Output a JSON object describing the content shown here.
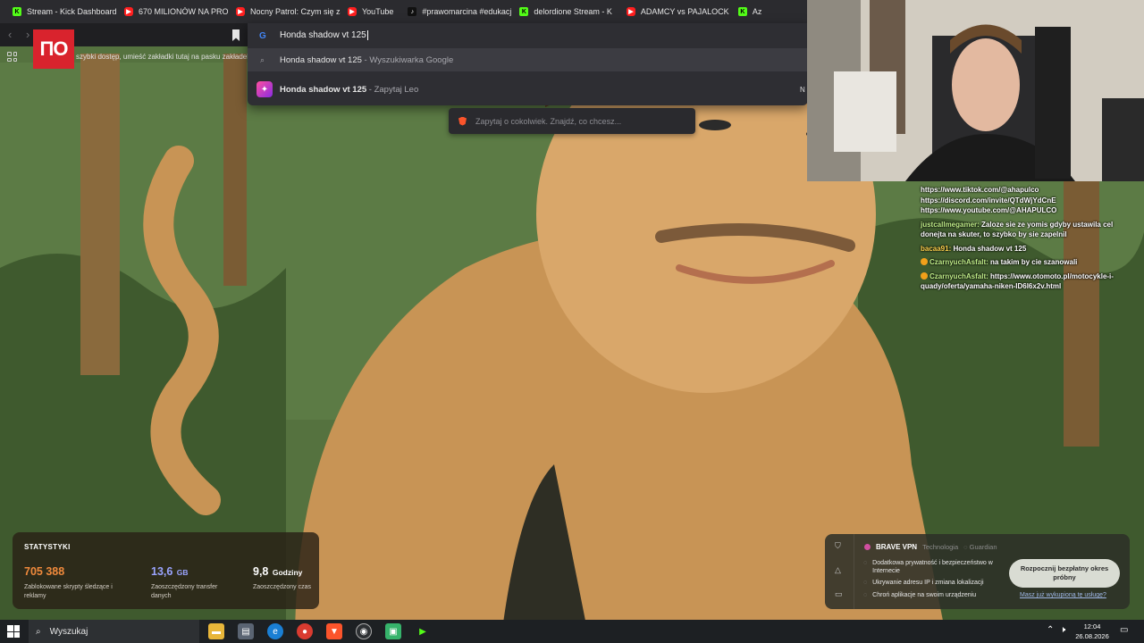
{
  "bookmarks": [
    {
      "icon": "kick-icon",
      "label": "Stream - Kick Dashboard"
    },
    {
      "icon": "youtube-icon",
      "label": "670 MILIONÓW NA PROM"
    },
    {
      "icon": "youtube-icon",
      "label": "Nocny Patrol: Czym się za"
    },
    {
      "icon": "youtube-icon",
      "label": "YouTube"
    },
    {
      "icon": "tiktok-icon",
      "label": "#prawomarcina #edukacj"
    },
    {
      "icon": "kick-icon",
      "label": "delordione Stream - K"
    },
    {
      "icon": "youtube-icon",
      "label": "ADAMCY vs PAJALOCK K"
    },
    {
      "icon": "kick-icon",
      "label": "Az"
    }
  ],
  "omnibox": {
    "query": "Honda shadow vt 125",
    "suggestions": [
      {
        "main": "Honda shadow vt 125",
        "suffix": " - Wyszukiwarka Google"
      },
      {
        "main": "Honda shadow vt 125",
        "suffix": " - Zapytaj Leo"
      }
    ],
    "edge_letter": "N"
  },
  "bookmarks_hint": "szybki dostęp, umieść zakładki tutaj na pasku zakładek",
  "leo_placeholder": "Zapytaj o cokolwiek. Znajdź, co chcesz...",
  "chat": {
    "lines": [
      {
        "user": "",
        "text": "https://www.tiktok.com/@ahapulco"
      },
      {
        "user": "",
        "text": "https://discord.com/invite/QTdWjYdCnE"
      },
      {
        "user": "",
        "text": "https://www.youtube.com/@AHAPULCO"
      },
      {
        "user": "justcallmegamer:",
        "text": " Zaloze sie ze yomis gdyby ustawila cel donejta na skuter, to szybko by sie zapelnil"
      },
      {
        "user": "bacaa91:",
        "text": " Honda shadow vt 125"
      },
      {
        "user": "CzarnyuchAsfalt:",
        "text": " na takim by cie szanowali"
      },
      {
        "user": "CzarnyuchAsfalt:",
        "text": " https://www.otomoto.pl/motocykle-i-quady/oferta/yamaha-niken-ID6l6x2v.html"
      }
    ]
  },
  "stats": {
    "title": "STATYSTYKI",
    "items": [
      {
        "value": "705 388",
        "unit": "",
        "desc": "Zablokowane skrypty śledzące i reklamy",
        "color": "#f08a3c"
      },
      {
        "value": "13,6",
        "unit": "GB",
        "desc": "Zaoszczędzony transfer danych",
        "color": "#9aa4ff"
      },
      {
        "value": "9,8",
        "unit": "Godziny",
        "desc": "Zaoszczędzony czas",
        "color": "#ffffff"
      }
    ]
  },
  "vpn": {
    "name": "BRAVE VPN",
    "tech": "Technologia",
    "partner": "Guardian",
    "features": [
      "Dodatkowa prywatność i bezpieczeństwo w Internecie",
      "Ukrywanie adresu IP i zmiana lokalizacji",
      "Chroń aplikacje na swoim urządzeniu"
    ],
    "cta": "Rozpocznij bezpłatny okres próbny",
    "link": "Masz już wykupioną tę usługę?"
  },
  "taskbar": {
    "search_placeholder": "Wyszukaj",
    "time": "12:04",
    "date": "26.08.2026"
  }
}
